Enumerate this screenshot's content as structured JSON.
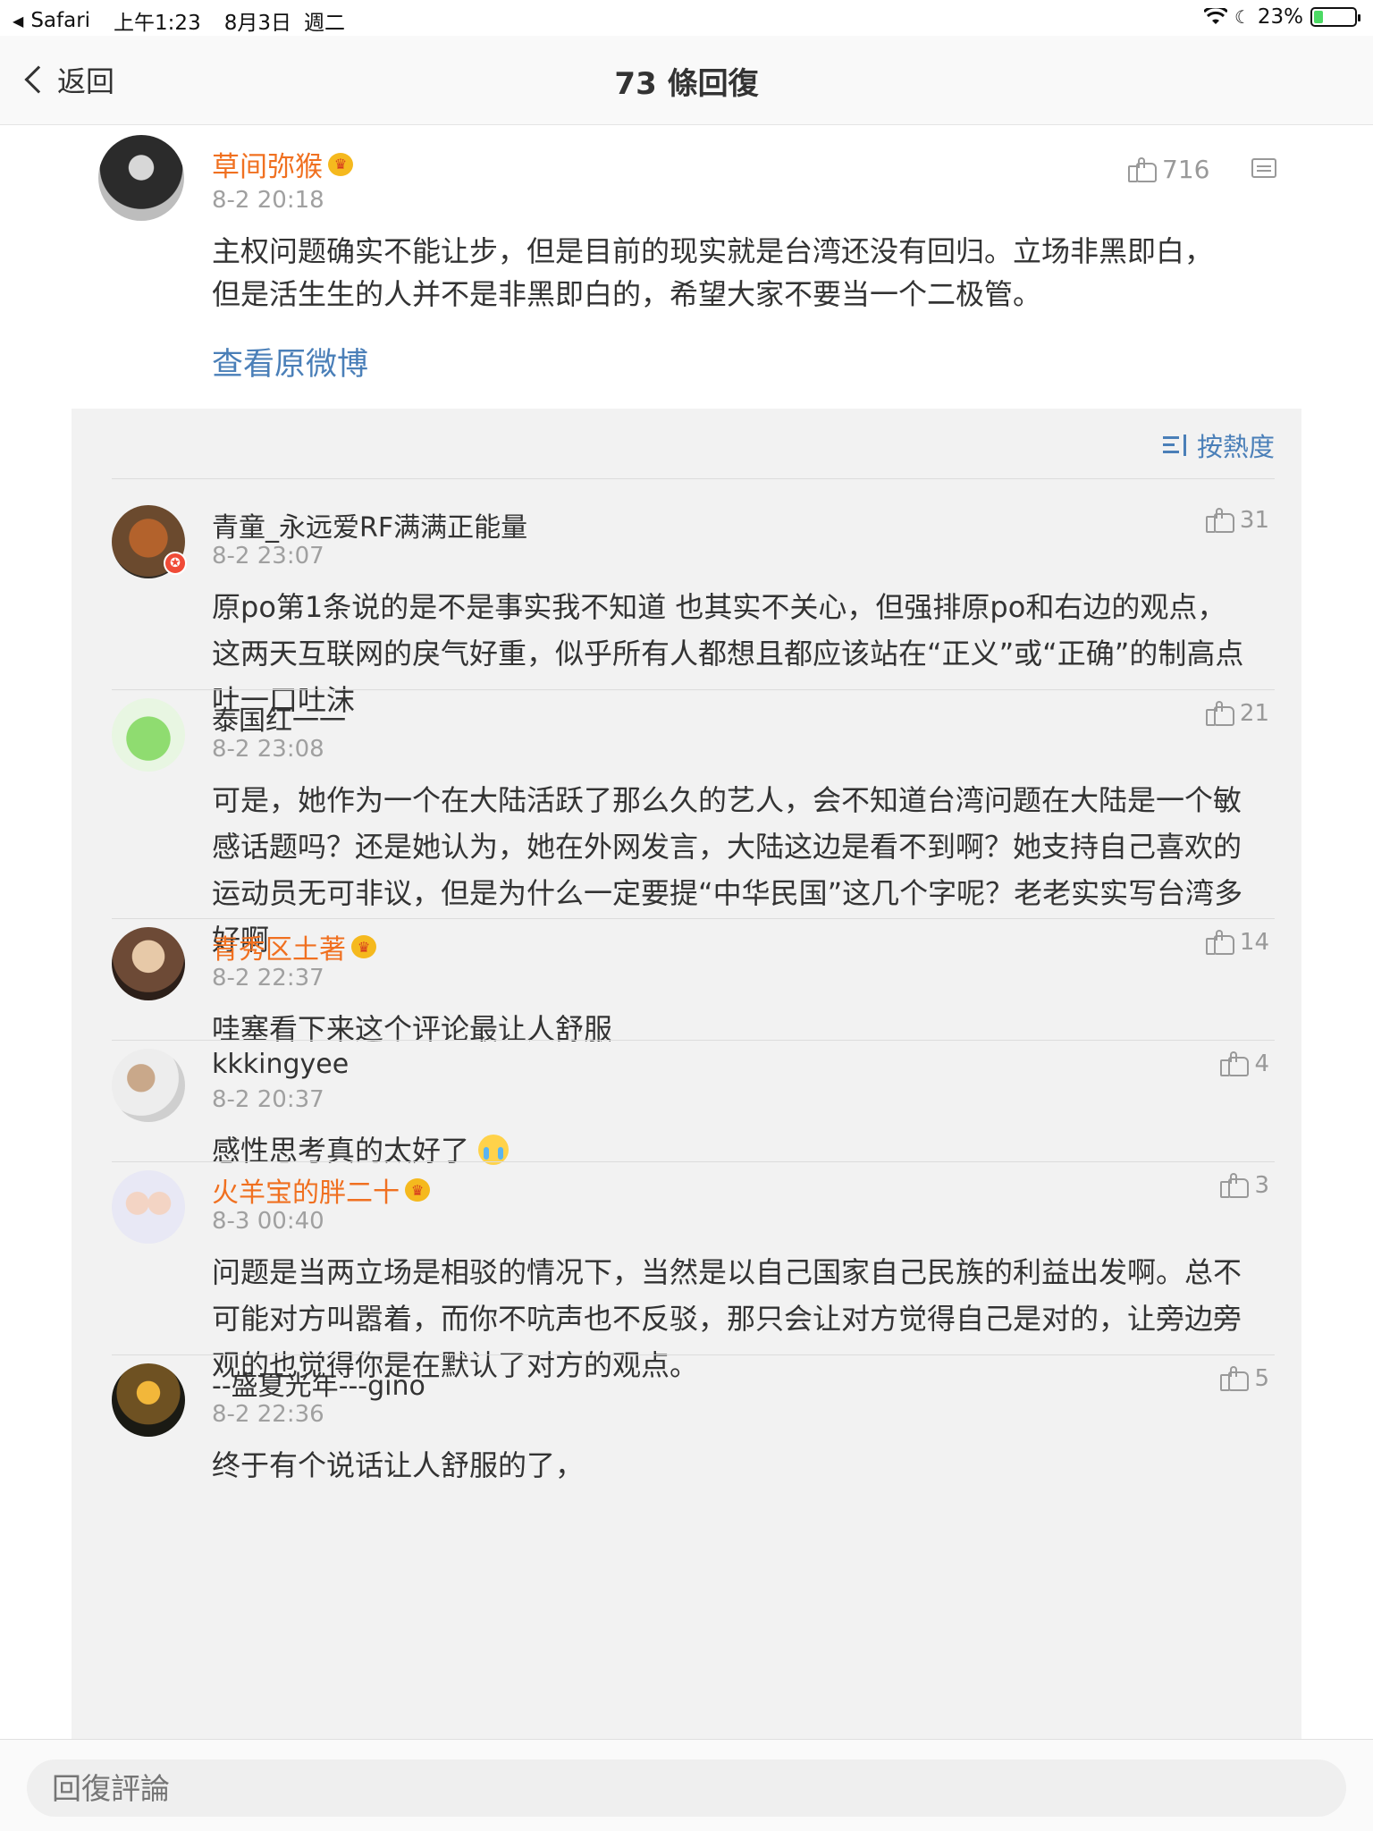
{
  "status_bar": {
    "app": "Safari",
    "time": "上午1:23",
    "date": "8月3日",
    "weekday": "週二",
    "battery": "23%"
  },
  "nav": {
    "back_label": "返回",
    "title": "73 條回復"
  },
  "post": {
    "author": "草间弥猴",
    "time": "8-2 20:18",
    "likes": "716",
    "body": "主权问题确实不能让步，但是目前的现实就是台湾还没有回归。立场非黑即白，但是活生生的人并不是非黑即白的，希望大家不要当一个二极管。",
    "view_original": "查看原微博"
  },
  "sort_label": "按熱度",
  "comments": [
    {
      "name": "青童_永远爱RF满满正能量",
      "time": "8-2 23:07",
      "likes": "31",
      "body": "原po第1条说的是不是事实我不知道 也其实不关心，但强排原po和右边的观点，这两天互联网的戾气好重，似乎所有人都想且都应该站在“正义”或“正确”的制高点吐一口吐沫"
    },
    {
      "name": "泰国红一一",
      "time": "8-2 23:08",
      "likes": "21",
      "body": "可是，她作为一个在大陆活跃了那么久的艺人，会不知道台湾问题在大陆是一个敏感话题吗？还是她认为，她在外网发言，大陆这边是看不到啊？她支持自己喜欢的运动员无可非议，但是为什么一定要提“中华民国”这几个字呢？老老实实写台湾多好啊"
    },
    {
      "name": "青秀区土著",
      "time": "8-2 22:37",
      "likes": "14",
      "body": "哇塞看下来这个评论最让人舒服"
    },
    {
      "name": "kkkingyee",
      "time": "8-2 20:37",
      "likes": "4",
      "body": "感性思考真的太好了"
    },
    {
      "name": "火羊宝的胖二十",
      "time": "8-3 00:40",
      "likes": "3",
      "body": "问题是当两立场是相驳的情况下，当然是以自己国家自己民族的利益出发啊。总不可能对方叫嚣着，而你不吭声也不反驳，那只会让对方觉得自己是对的，让旁边旁观的也觉得你是在默认了对方的观点。"
    },
    {
      "name": "--盛夏光年---gino",
      "time": "8-2 22:36",
      "likes": "5",
      "body": "终于有个说话让人舒服的了，"
    }
  ],
  "reply": {
    "placeholder": "回復評論"
  },
  "colors": {
    "vip_name": "#f07020",
    "link": "#4a7fb8",
    "panel_bg": "#f2f2f2"
  },
  "icons": [
    "back-chevron-icon",
    "wifi-icon",
    "moon-icon",
    "battery-icon",
    "thumb-up-icon",
    "comment-icon",
    "sort-icon",
    "crown-icon",
    "crying-emoji-icon"
  ]
}
